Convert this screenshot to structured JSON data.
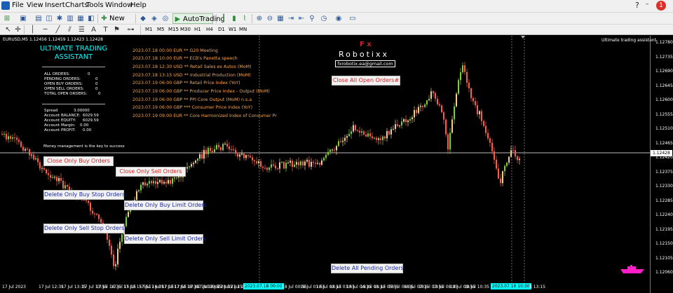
{
  "menubar": {
    "items": [
      "File",
      "View",
      "Insert",
      "Charts",
      "Tools",
      "Window",
      "Help"
    ],
    "notification_count": "1"
  },
  "toolbar": {
    "new_order_label": "New Order",
    "autotrading_label": "AutoTrading"
  },
  "timeframes": [
    "M1",
    "M5",
    "M15",
    "M30",
    "H1",
    "H4",
    "D1",
    "W1",
    "MN"
  ],
  "chart": {
    "symbol_info": "EURUSD,M5  1.12456 1.12459 1.12423 1.12428",
    "ea_name": "Ultimate trading assistant",
    "current_price": "1.12428",
    "price_ticks": [
      "1.12780",
      "1.12735",
      "1.12690",
      "1.12645",
      "1.12600",
      "1.12555",
      "1.12510",
      "1.12465",
      "1.12420",
      "1.12375",
      "1.12330",
      "1.12285",
      "1.12240",
      "1.12195",
      "1.12150",
      "1.12105",
      "1.12060"
    ],
    "time_ticks": [
      "17 Jul 2023",
      "17 Jul 12:35",
      "17 Jul 13:15",
      "17 Jul 13:55",
      "17 Jul 14:35",
      "17 Jul 15:15",
      "17 Jul 15:55",
      "17 Jul 16:35",
      "17 Jul 17:15",
      "17 Jul 17:55",
      "17 Jul 18:35",
      "17 Jul 19:15",
      "17 Jul 19:55",
      "17 Jul 20:35",
      "17 Jul 21:15",
      "17 Jul 21:55",
      "2023.07.18 00:00",
      "18 Jul 00:55",
      "18 Jul 01:55",
      "18 Jul 03:15",
      "18 Jul 03:55",
      "18 Jul 04:35",
      "18 Jul 05:15",
      "18 Jul 05:55",
      "18 Jul 06:35",
      "18 Jul 07:15",
      "18 Jul 07:55",
      "18 Jul 08:35",
      "18 Jul 09:55",
      "18 Jul 10:35",
      "2023.07.18 10:30",
      "8 13:15"
    ]
  },
  "assistant": {
    "title_line1": "ULTIMATE TRADING",
    "title_line2": "ASSISTANT",
    "all_orders_label": "ALL ORDERS:",
    "all_orders": "0",
    "pending_orders_label": "PENDING ORDERS:",
    "pending_orders": "0",
    "open_buy_label": "OPEN BUY ORDERS:",
    "open_buy": "0",
    "open_sell_label": "OPEN SELL ORDERS:",
    "open_sell": "0",
    "total_open_label": "TOTAL OPEN ORDERS:",
    "total_open": "0",
    "spread_label": "Spread",
    "spread": "3.00000",
    "balance_label": "Account BALANCE:",
    "balance": "6029.59",
    "equity_label": "Account EQUITY:",
    "equity": "6029.59",
    "margin_label": "Account Margin:",
    "margin": "0.00",
    "profit_label": "Account PROFIT:",
    "profit": "0.00",
    "motto": "Money management is the key to success"
  },
  "news": [
    "2023.07.18 00:00 EUR **  G20 Meeting",
    "2023.07.18 10:00 EUR **  ECB's Panetta speech",
    "2023.07.18 12:30 USD **  Retail Sales ex Autos (MoM)",
    "2023.07.18 13:15 USD **  Industrial Production (MoM)",
    "2023.07.19 06:00 GBP **  Retail Price Index (YoY)",
    "2023.07.19 06:00 GBP **  Producer Price Index - Output (MoM)",
    "2023.07.19 06:00 GBP **  PPI Core Output (MoM) n.s.a",
    "2023.07.19 06:00 GBP ***  Consumer Price Index (YoY)",
    "2023.07.19 09:00 EUR **  Core Harmonized Index of Consumer Pr"
  ],
  "branding": {
    "fx": "F x",
    "name": "Robotixx",
    "email": "fxrobotix.ea@gmail.com"
  },
  "buttons": {
    "close_all_open": "Close All Open Orders#",
    "close_buy": "Close Only Buy Orders",
    "close_sell": "Close Only Sell Orders",
    "delete_buy_stop": "Delete Only Buy Stop Orders",
    "delete_buy_limit": "Delete Only Buy Limit Orders",
    "delete_sell_stop": "Delete Only Sell Stop Orders",
    "delete_sell_limit": "Delete Only Sell Limit Orders",
    "delete_all_pending": "Delete All Pending Orders"
  },
  "colors": {
    "bull_candle": "#f0d090",
    "bear_candle": "#ff5b4a",
    "bull_accent": "#7ecf3a",
    "title_cyan": "#00ffff",
    "news_orange": "#f7a44a"
  }
}
